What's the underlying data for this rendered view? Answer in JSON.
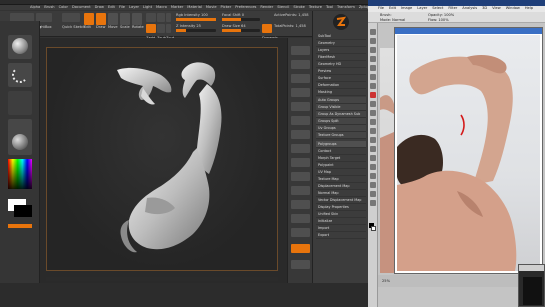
{
  "zbrush": {
    "window_title": "ZBrush 4R6 (Professional 64bit) - [Lightbox - Tool: Simple3D] - Free Mem 3.1 GB",
    "menu_items": [
      "Alpha",
      "Brush",
      "Color",
      "Document",
      "Draw",
      "Edit",
      "File",
      "Layer",
      "Light",
      "Macro",
      "Marker",
      "Material",
      "Movie",
      "Picker",
      "Preferences",
      "Render",
      "Stencil",
      "Stroke",
      "Texture",
      "Tool",
      "Transform",
      "Zplugin",
      "Zscript"
    ],
    "toolbar": {
      "projection_master": "Projection Master",
      "lightbox": "LightBox",
      "quick_sketch": "Quick Sketch",
      "edit": "Edit",
      "draw": "Draw",
      "move": "Move",
      "scale": "Scale",
      "rotate": "Rotate",
      "mrgb": "Mrgb",
      "rgb": "Rgb",
      "m": "M",
      "zadd": "Zadd",
      "zsub": "Zsub",
      "zcut": "Zcut",
      "rgb_intensity": "Rgb Intensity 100",
      "z_intensity": "Z Intensity 25",
      "focal_shift": "Focal Shift 0",
      "draw_size": "Draw Size 64",
      "dynamic": "Dynamic",
      "active_points": "ActivePoints: 1,458",
      "total_points": "TotalPoints: 1,458",
      "zintensity_fill": 0.25,
      "drawsize_fill": 0.5
    },
    "tray": {
      "top_items": [
        "SubTool",
        "Geometry",
        "Layers",
        "FiberMesh",
        "Geometry HD",
        "Preview",
        "Surface",
        "Deformation",
        "Masking"
      ],
      "polygroups_header": "Polygroups",
      "polygroups": [
        "Auto Groups",
        "Group Visible",
        "Group As Dynamesh Sub",
        "Groups Split",
        "Uv Groups",
        "Texture Groups",
        "Feature Groups",
        "Polypaint Groups",
        "Crease PG",
        "From Masking",
        "Inner Groups",
        "Outer Groups"
      ],
      "bottom_items": [
        "Contact",
        "Morph Target",
        "Polypaint",
        "UV Map",
        "Texture Map",
        "Displacement Map",
        "Normal Map",
        "Vector Displacement Map",
        "Display Properties",
        "Unified Skin",
        "Initialize",
        "Import",
        "Export"
      ]
    }
  },
  "photoshop": {
    "window_title": "Adobe Photoshop",
    "menu_items": [
      "File",
      "Edit",
      "Image",
      "Layer",
      "Select",
      "Filter",
      "Analysis",
      "3D",
      "View",
      "Window",
      "Help"
    ],
    "options": [
      "Brush:",
      "Mode: Normal",
      "Opacity: 100%",
      "Flow: 100%"
    ],
    "doc_title": "DSC_2268.JPG @ 25% (RGB/8)",
    "status": "25%"
  },
  "colors": {
    "zbrush_accent": "#e8740c",
    "ps_title": "#1f3f7a"
  }
}
